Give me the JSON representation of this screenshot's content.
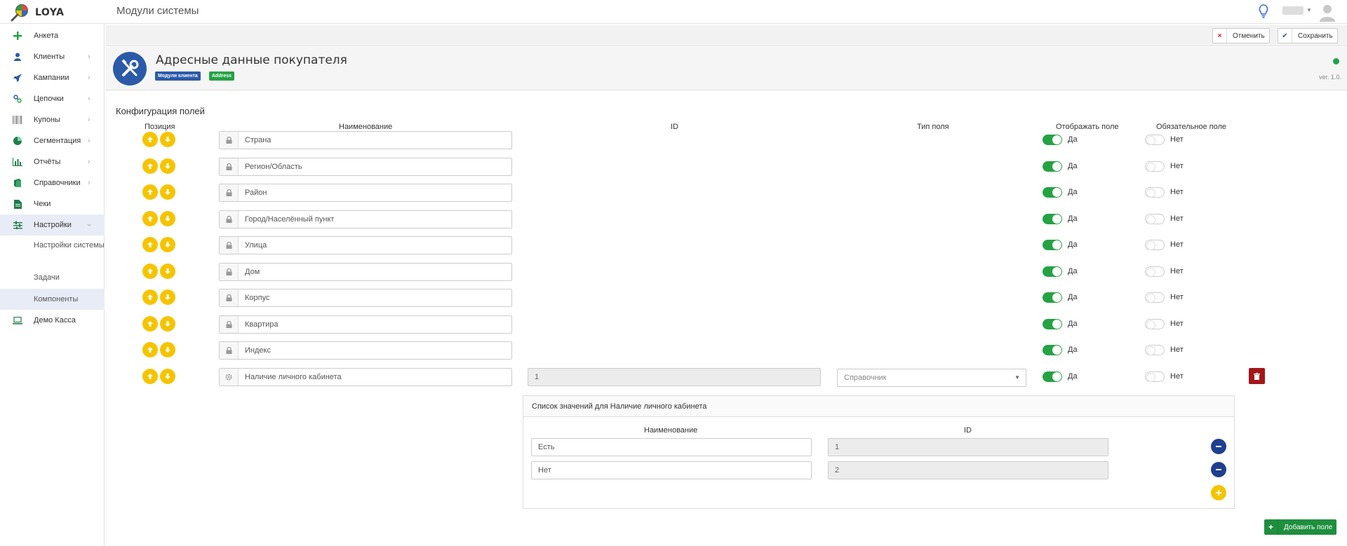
{
  "app": {
    "logo_text": "LOYA",
    "page_title": "Модули системы"
  },
  "sidebar": {
    "items": [
      {
        "label": "Анкета",
        "icon": "plus-icon"
      },
      {
        "label": "Клиенты",
        "icon": "user-icon"
      },
      {
        "label": "Кампании",
        "icon": "rocket-icon"
      },
      {
        "label": "Цепочки",
        "icon": "chain-icon"
      },
      {
        "label": "Купоны",
        "icon": "barcode-icon"
      },
      {
        "label": "Сегментация",
        "icon": "pie-icon"
      },
      {
        "label": "Отчёты",
        "icon": "chart-icon"
      },
      {
        "label": "Справочники",
        "icon": "book-icon"
      },
      {
        "label": "Чеки",
        "icon": "receipt-icon"
      },
      {
        "label": "Настройки",
        "icon": "sliders-icon"
      },
      {
        "label": "Демо Касса",
        "icon": "laptop-icon"
      }
    ],
    "sub_items": [
      "Настройки системы",
      "Задачи",
      "Компоненты"
    ]
  },
  "toolbar": {
    "cancel_label": "Отменить",
    "save_label": "Сохранить"
  },
  "module": {
    "title": "Адресные данные покупателя",
    "badge1": "Модули клиента",
    "badge2": "Address",
    "version": "ver. 1.0."
  },
  "fields": {
    "section_title": "Конфигурация полей",
    "headers": {
      "position": "Позиция",
      "name": "Наименование",
      "id": "ID",
      "type": "Тип поля",
      "visible": "Отображать поле",
      "required": "Обязательное поле"
    },
    "yes": "Да",
    "no": "Нет",
    "rows": [
      {
        "name": "Страна"
      },
      {
        "name": "Регион/Область"
      },
      {
        "name": "Район"
      },
      {
        "name": "Город/Населённый пункт"
      },
      {
        "name": "Улица"
      },
      {
        "name": "Дом"
      },
      {
        "name": "Корпус"
      },
      {
        "name": "Квартира"
      },
      {
        "name": "Индекс"
      }
    ],
    "custom": {
      "name": "Наличие личного кабинета",
      "id": "1",
      "type": "Справочник"
    }
  },
  "values_panel": {
    "title": "Список значений для Наличие личного кабинета",
    "col_name": "Наименование",
    "col_id": "ID",
    "rows": [
      {
        "name": "Есть",
        "id": "1"
      },
      {
        "name": "Нет",
        "id": "2"
      }
    ]
  },
  "add_field_label": "Добавить поле",
  "colors": {
    "accent_yellow": "#f5c400",
    "toggle_green": "#25a244",
    "brand_blue": "#2b5aa8",
    "danger": "#a4161a"
  }
}
